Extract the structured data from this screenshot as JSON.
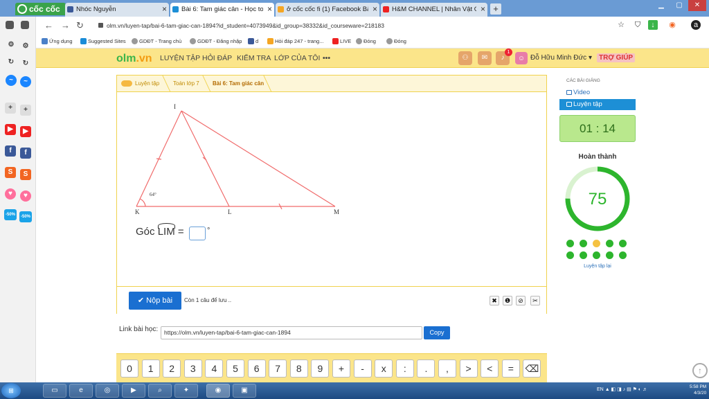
{
  "browser": {
    "brand": "cốc cốc",
    "tabs": [
      {
        "label": "Nhóc Nguyễn",
        "icon": "facebook-icon",
        "color": "#3b5998"
      },
      {
        "label": "Bài 6: Tam giác cân - Học toán",
        "icon": "cloud-icon",
        "color": "#1d8fd6"
      },
      {
        "label": "ở cốc cốc fi (1) Facebook Bài",
        "icon": "hoidap-icon",
        "color": "#f5a623"
      },
      {
        "label": "H&M CHANNEL | Nhân Vật G",
        "icon": "youtube-icon",
        "color": "#e22"
      }
    ],
    "new_tab": "+",
    "url": "olm.vn/luyen-tap/bai-6-tam-giac-can-1894?id_student=4073949&id_group=38332&id_courseware=218183",
    "bookmarks": [
      "Ứng dụng",
      "Suggested Sites",
      "GDĐT - Trang chủ",
      "GDĐT - Đăng nhập",
      "d",
      "Hỏi đáp 247 - trang...",
      "LIVE",
      "Đóng",
      "Đóng"
    ],
    "sidebar_apps": [
      "1",
      "2",
      "S",
      "♥",
      "-50%"
    ]
  },
  "site": {
    "logo_a": "olm",
    "logo_b": ".vn",
    "nav": [
      "LUYỆN TẬP",
      "HỎI ĐÁP",
      "KIỂM TRA",
      "LỚP CỦA TÔI",
      "•••"
    ],
    "notification_count": "1",
    "user_name": "Đỗ Hữu Minh Đức ▾",
    "help": "TRỢ GIÚP"
  },
  "breadcrumb": [
    "Luyện tập",
    "Toán lớp 7",
    "Bài 6: Tam giác cân"
  ],
  "figure": {
    "labels": {
      "I": "I",
      "K": "K",
      "L": "L",
      "M": "M"
    },
    "angle_label": "64°"
  },
  "question": {
    "prefix": "Góc ",
    "angle": "LIM",
    "equals": " = ",
    "unit": "°",
    "answer_value": "",
    "answer_placeholder": ""
  },
  "footer": {
    "submit": "✔ Nộp bài",
    "remaining": "Còn 1 câu để lưu ..",
    "tools": [
      "✖",
      "❶",
      "⊘",
      "✂"
    ]
  },
  "link": {
    "label": "Link bài học:",
    "url": "https://olm.vn/luyen-tap/bai-6-tam-giac-can-1894",
    "copy": "Copy"
  },
  "sidebar": {
    "heading": "CÁC BÀI GIẢNG",
    "items": [
      {
        "label": "Video",
        "active": false
      },
      {
        "label": "Luyện tập",
        "active": true
      }
    ],
    "timer": "01 : 14",
    "complete_label": "Hoàn thành",
    "score": "75",
    "progress_fraction": 0.75,
    "dot_colors": [
      "#2db52d",
      "#2db52d",
      "#f5c242",
      "#2db52d",
      "#2db52d",
      "#2db52d",
      "#2db52d",
      "#2db52d",
      "#2db52d",
      "#2db52d"
    ],
    "retry": "Luyện tập lại"
  },
  "keypad": [
    "0",
    "1",
    "2",
    "3",
    "4",
    "5",
    "6",
    "7",
    "8",
    "9",
    "+",
    "-",
    "x",
    ":",
    ".",
    ",",
    ">",
    "<",
    "=",
    "⌫"
  ],
  "taskbar": {
    "tray": "EN",
    "time": "5:58 PM",
    "date": "4/3/20"
  }
}
